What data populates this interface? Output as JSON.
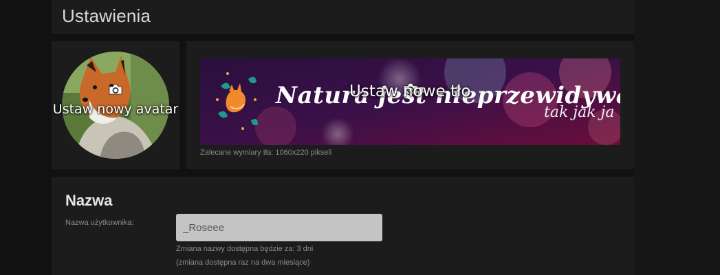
{
  "header": {
    "title": "Ustawienia"
  },
  "avatar": {
    "label": "Ustaw nowy avatar",
    "camera_icon": "camera-icon"
  },
  "background": {
    "label": "Ustaw nowe tło",
    "camera_icon": "camera-icon",
    "hint": "Zalecane wymiary tła: 1060x220 pikseli",
    "banner_text": "Natura jest nieprzewidywalna",
    "banner_subtext": "tak jak ja"
  },
  "name_section": {
    "title": "Nazwa",
    "field_label": "Nazwa użytkownika:",
    "value": "_Roseee",
    "note_line1": "Zmiana nazwy dostępna będzie za: 3 dni",
    "note_line2": "(zmiana dostępna raz na dwa miesiące)"
  },
  "colors": {
    "page_background": "#111111",
    "panel_background": "#1c1c1c",
    "input_background": "#c4c4c4",
    "banner_purple": "#3a0f4a"
  }
}
